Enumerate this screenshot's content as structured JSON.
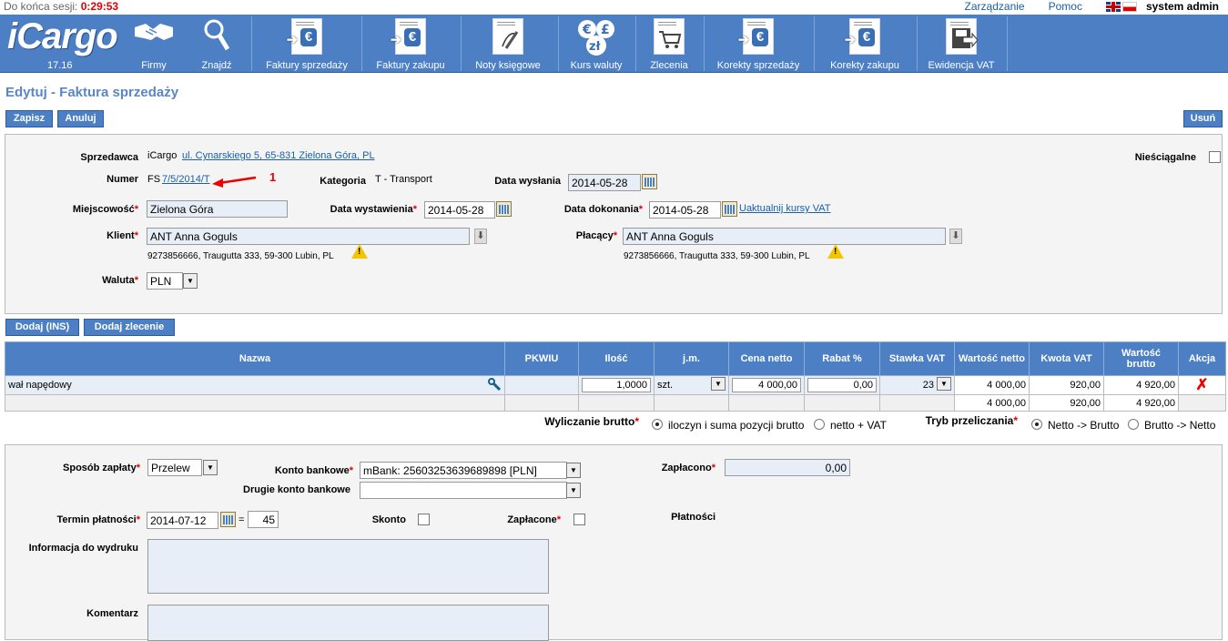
{
  "session": {
    "label": "Do końca sesji:",
    "time": "0:29:53"
  },
  "top_links": {
    "management": "Zarządzanie",
    "help": "Pomoc",
    "user": "system admin"
  },
  "logo": {
    "text": "iCargo",
    "version": "17.16"
  },
  "nav": [
    {
      "label": "Firmy",
      "icon": "handshake-icon"
    },
    {
      "label": "Znajdź",
      "icon": "magnifier-icon"
    },
    {
      "label": "Faktury sprzedaży",
      "icon": "sales-invoice-icon"
    },
    {
      "label": "Faktury zakupu",
      "icon": "purchase-invoice-icon"
    },
    {
      "label": "Noty księgowe",
      "icon": "note-icon"
    },
    {
      "label": "Kurs waluty",
      "icon": "currency-icon"
    },
    {
      "label": "Zlecenia",
      "icon": "order-cart-icon"
    },
    {
      "label": "Korekty sprzedaży",
      "icon": "sales-correction-icon"
    },
    {
      "label": "Korekty zakupu",
      "icon": "purchase-correction-icon"
    },
    {
      "label": "Ewidencja VAT",
      "icon": "vat-register-icon"
    }
  ],
  "page_title": "Edytuj - Faktura sprzedaży",
  "buttons": {
    "save": "Zapisz",
    "cancel": "Anuluj",
    "delete": "Usuń",
    "add_ins": "Dodaj (INS)",
    "add_order": "Dodaj zlecenie"
  },
  "form": {
    "seller_label": "Sprzedawca",
    "seller_name": "iCargo",
    "seller_address": "ul. Cynarskiego 5, 65-831 Zielona Góra, PL",
    "number_label": "Numer",
    "number_prefix": "FS",
    "number_value": "7/5/2014/T",
    "annotation": "1",
    "category_label": "Kategoria",
    "category_value": "T - Transport",
    "send_date_label": "Data wysłania",
    "send_date": "2014-05-28",
    "uncollectible_label": "Nieściągalne",
    "city_label": "Miejscowość",
    "city_value": "Zielona Góra",
    "issue_date_label": "Data wystawienia",
    "issue_date": "2014-05-28",
    "exec_date_label": "Data dokonania",
    "exec_date": "2014-05-28",
    "update_rates_link": "Uaktualnij kursy VAT",
    "client_label": "Klient",
    "client_value": "ANT Anna Goguls",
    "client_address": "9273856666, Traugutta 333, 59-300 Lubin, PL",
    "payer_label": "Płacący",
    "payer_value": "ANT Anna Goguls",
    "payer_address": "9273856666, Traugutta 333, 59-300 Lubin, PL",
    "currency_label": "Waluta",
    "currency_value": "PLN"
  },
  "table": {
    "headers": [
      "Nazwa",
      "PKWIU",
      "Ilość",
      "j.m.",
      "Cena netto",
      "Rabat %",
      "Stawka VAT",
      "Wartość netto",
      "Kwota VAT",
      "Wartość brutto",
      "Akcja"
    ],
    "rows": [
      {
        "name": "wał napędowy",
        "pkwiu": "",
        "qty": "1,0000",
        "unit": "szt.",
        "net_price": "4 000,00",
        "discount": "0,00",
        "vat_rate": "23",
        "net_value": "4 000,00",
        "vat_amount": "920,00",
        "gross_value": "4 920,00"
      }
    ],
    "totals": {
      "net_value": "4 000,00",
      "vat_amount": "920,00",
      "gross_value": "4 920,00"
    }
  },
  "calc": {
    "gross_label": "Wyliczanie brutto",
    "gross_opt1": "iloczyn i suma pozycji brutto",
    "gross_opt2": "netto + VAT",
    "mode_label": "Tryb przeliczania",
    "mode_opt1": "Netto -> Brutto",
    "mode_opt2": "Brutto -> Netto"
  },
  "payment": {
    "method_label": "Sposób zapłaty",
    "method_value": "Przelew",
    "account_label": "Konto bankowe",
    "account_value": "mBank: 25603253639689898 [PLN]",
    "second_account_label": "Drugie konto bankowe",
    "second_account_value": "",
    "paid_label": "Zapłacono",
    "paid_value": "0,00",
    "due_label": "Termin płatności",
    "due_date": "2014-07-12",
    "eq": "=",
    "due_days": "45",
    "discount_label": "Skonto",
    "paid_flag_label": "Zapłacone",
    "payments_label": "Płatności",
    "print_info_label": "Informacja do wydruku",
    "comment_label": "Komentarz"
  }
}
